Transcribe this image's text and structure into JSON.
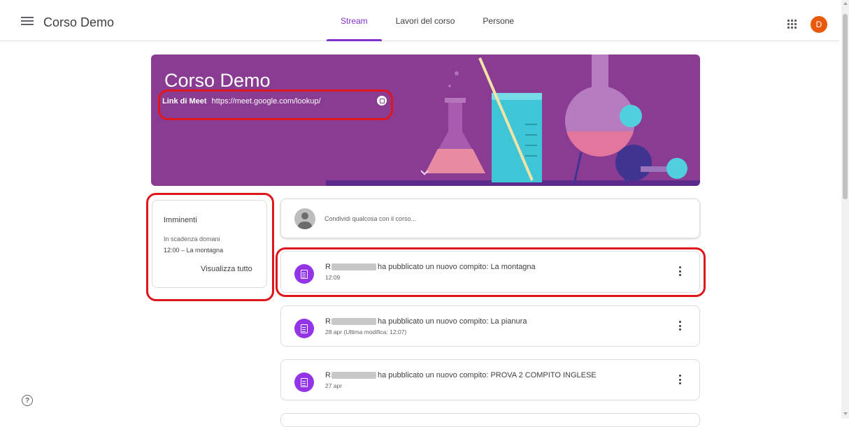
{
  "header": {
    "menu_icon": "menu-icon",
    "title": "Corso Demo",
    "tabs": [
      {
        "label": "Stream",
        "active": true
      },
      {
        "label": "Lavori del corso",
        "active": false
      },
      {
        "label": "Persone",
        "active": false
      }
    ],
    "apps_icon": "apps-grid-icon",
    "avatar_letter": "D"
  },
  "banner": {
    "title": "Corso Demo",
    "meet_label": "Link di Meet",
    "meet_url": "https://meet.google.com/lookup/",
    "background_color": "#8a3c93"
  },
  "upcoming": {
    "title": "Imminenti",
    "due_text": "In scadenza domani",
    "item": "12:00 – La montagna",
    "view_all": "Visualizza tutto"
  },
  "share": {
    "placeholder": "Condividi qualcosa con il corso..."
  },
  "posts": [
    {
      "author_initial": "R",
      "text": "ha pubblicato un nuovo compito: La montagna",
      "time": "12:09"
    },
    {
      "author_initial": "R",
      "text": "ha pubblicato un nuovo compito: La pianura",
      "time": "28 apr (Ultima modifica: 12:07)"
    },
    {
      "author_initial": "R",
      "text": "ha pubblicato un nuovo compito: PROVA 2 COMPITO INGLESE",
      "time": "27 apr"
    }
  ],
  "colors": {
    "accent": "#8430ce",
    "assignment_icon": "#9334e6",
    "highlight": "#e0161d",
    "avatar": "#e8590c"
  },
  "help_icon": "?"
}
